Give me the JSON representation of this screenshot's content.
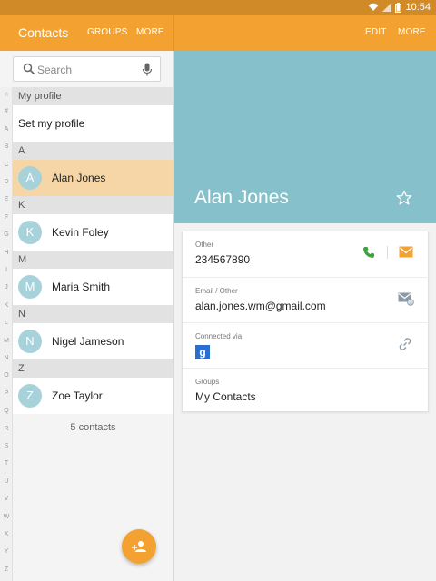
{
  "status": {
    "time": "10:54"
  },
  "appbar": {
    "title": "Contacts",
    "groups": "GROUPS",
    "more_left": "MORE",
    "edit": "EDIT",
    "more_right": "MORE"
  },
  "search": {
    "placeholder": "Search"
  },
  "index_letters": [
    "☆",
    "#",
    "A",
    "B",
    "C",
    "D",
    "E",
    "F",
    "G",
    "H",
    "I",
    "J",
    "K",
    "L",
    "M",
    "N",
    "O",
    "P",
    "Q",
    "R",
    "S",
    "T",
    "U",
    "V",
    "W",
    "X",
    "Y",
    "Z"
  ],
  "list": {
    "my_profile_header": "My profile",
    "set_profile": "Set my profile",
    "sections": [
      {
        "letter": "A",
        "contacts": [
          {
            "initial": "A",
            "name": "Alan Jones"
          }
        ]
      },
      {
        "letter": "K",
        "contacts": [
          {
            "initial": "K",
            "name": "Kevin Foley"
          }
        ]
      },
      {
        "letter": "M",
        "contacts": [
          {
            "initial": "M",
            "name": "Maria Smith"
          }
        ]
      },
      {
        "letter": "N",
        "contacts": [
          {
            "initial": "N",
            "name": "Nigel Jameson"
          }
        ]
      },
      {
        "letter": "Z",
        "contacts": [
          {
            "initial": "Z",
            "name": "Zoe Taylor"
          }
        ]
      }
    ],
    "count": "5 contacts"
  },
  "detail": {
    "name": "Alan Jones",
    "phone_label": "Other",
    "phone_value": "234567890",
    "email_label": "Email / Other",
    "email_value": "alan.jones.wm@gmail.com",
    "connected_label": "Connected via",
    "groups_label": "Groups",
    "groups_value": "My Contacts"
  },
  "colors": {
    "accent": "#f3a232",
    "hero": "#86c1cb",
    "avatar": "#a8d2da",
    "selected": "#f6d6a6"
  }
}
